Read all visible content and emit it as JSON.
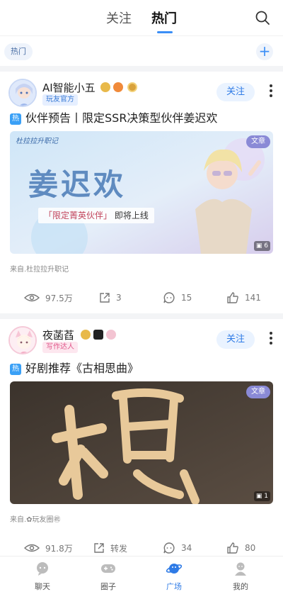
{
  "header": {
    "tabs": [
      {
        "label": "关注",
        "active": false
      },
      {
        "label": "热门",
        "active": true
      }
    ],
    "search_icon": "search-icon"
  },
  "chips": {
    "current": "热门",
    "add_icon": "+"
  },
  "posts": [
    {
      "author": "AI智能小五",
      "author_badge": "玩友官方",
      "follow_label": "关注",
      "hot_tag": "热",
      "title": "伙伴预告丨限定SSR决策型伙伴姜迟欢",
      "cover": {
        "logo_text": "杜拉拉升职记",
        "headline": "姜迟欢",
        "subline_highlight": "「限定菁英伙伴」",
        "subline_rest": "即将上线",
        "article_tag": "文章",
        "image_count": "6"
      },
      "source": "来自.杜拉拉升职记",
      "stats": {
        "views": "97.5万",
        "shares": "3",
        "comments": "15",
        "likes": "141"
      }
    },
    {
      "author": "夜菡萏",
      "author_badge": "写作达人",
      "follow_label": "关注",
      "hot_tag": "热",
      "title": "好剧推荐《古相思曲》",
      "cover": {
        "article_tag": "文章",
        "image_count": "1"
      },
      "source": "来自.✿玩友圈㊗",
      "stats": {
        "views": "91.8万",
        "shares": "转发",
        "comments": "34",
        "likes": "80"
      }
    }
  ],
  "bottom_nav": [
    {
      "label": "聊天",
      "icon": "chat-icon",
      "active": false
    },
    {
      "label": "圈子",
      "icon": "gamepad-icon",
      "active": false
    },
    {
      "label": "广场",
      "icon": "planet-icon",
      "active": true
    },
    {
      "label": "我的",
      "icon": "profile-icon",
      "active": false
    }
  ],
  "colors": {
    "accent": "#2f7be6",
    "hot_tag": "#3aa0f6",
    "official_badge": "#3a7bd5",
    "writer_badge": "#e0578a"
  }
}
